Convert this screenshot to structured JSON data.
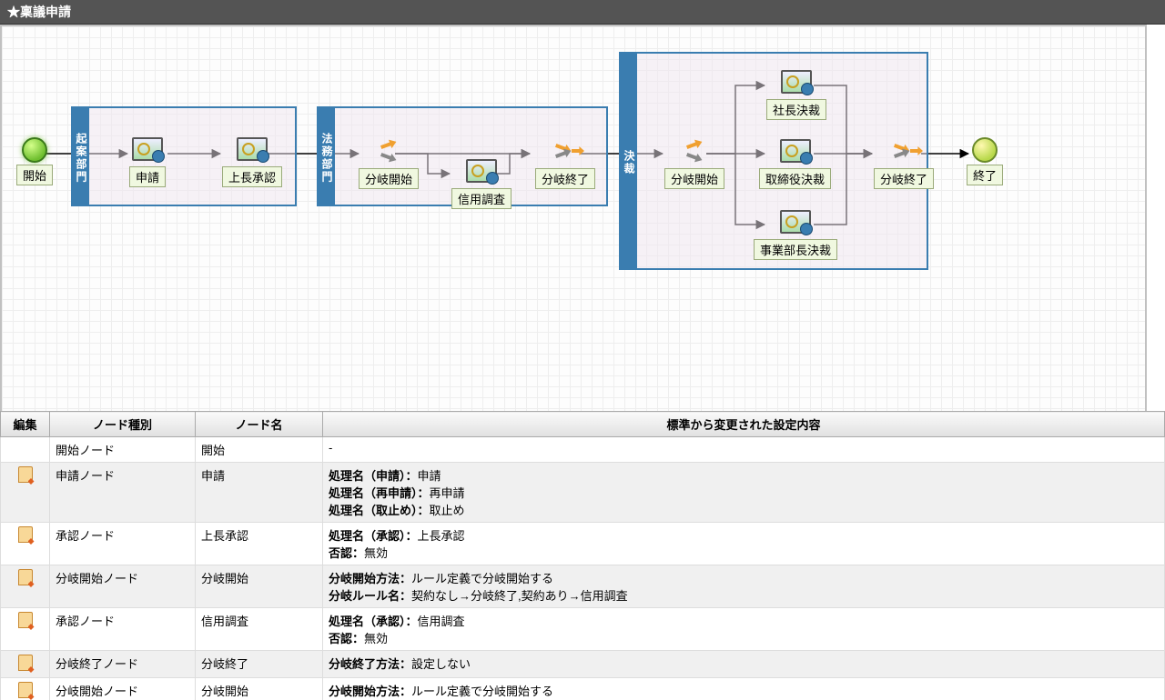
{
  "title": "★稟議申請",
  "labels": {
    "start": "開始",
    "end": "終了"
  },
  "swimlanes": {
    "kian": "起案部門",
    "houmu": "法務部門",
    "kessai": "決裁"
  },
  "nodes": {
    "shinsei": "申請",
    "joucho": "上長承認",
    "bunki_start1": "分岐開始",
    "shinyo": "信用調査",
    "bunki_end1": "分岐終了",
    "bunki_start2": "分岐開始",
    "shacho": "社長決裁",
    "torishimari": "取締役決裁",
    "jigyobu": "事業部長決裁",
    "bunki_end2": "分岐終了"
  },
  "table": {
    "headers": {
      "edit": "編集",
      "type": "ノード種別",
      "name": "ノード名",
      "settings": "標準から変更された設定内容"
    },
    "rows": [
      {
        "alt": false,
        "editable": false,
        "type": "開始ノード",
        "name": "開始",
        "details": [
          {
            "text": "-"
          }
        ]
      },
      {
        "alt": true,
        "editable": true,
        "type": "申請ノード",
        "name": "申請",
        "details": [
          {
            "label": "処理名（申請）：",
            "value": "申請"
          },
          {
            "label": "処理名（再申請）：",
            "value": "再申請"
          },
          {
            "label": "処理名（取止め）：",
            "value": "取止め"
          }
        ]
      },
      {
        "alt": false,
        "editable": true,
        "type": "承認ノード",
        "name": "上長承認",
        "details": [
          {
            "label": "処理名（承認）：",
            "value": "上長承認"
          },
          {
            "label": "否認：",
            "value": "無効"
          }
        ]
      },
      {
        "alt": true,
        "editable": true,
        "type": "分岐開始ノード",
        "name": "分岐開始",
        "details": [
          {
            "label": "分岐開始方法：",
            "value": "ルール定義で分岐開始する"
          },
          {
            "label": "分岐ルール名：",
            "value": "契約なし→分岐終了,契約あり→信用調査"
          }
        ]
      },
      {
        "alt": false,
        "editable": true,
        "type": "承認ノード",
        "name": "信用調査",
        "details": [
          {
            "label": "処理名（承認）：",
            "value": "信用調査"
          },
          {
            "label": "否認：",
            "value": "無効"
          }
        ]
      },
      {
        "alt": true,
        "editable": true,
        "type": "分岐終了ノード",
        "name": "分岐終了",
        "details": [
          {
            "label": "分岐終了方法：",
            "value": "設定しない"
          }
        ]
      },
      {
        "alt": false,
        "editable": true,
        "type": "分岐開始ノード",
        "name": "分岐開始",
        "details": [
          {
            "label": "分岐開始方法：",
            "value": "ルール定義で分岐開始する"
          }
        ]
      }
    ]
  }
}
